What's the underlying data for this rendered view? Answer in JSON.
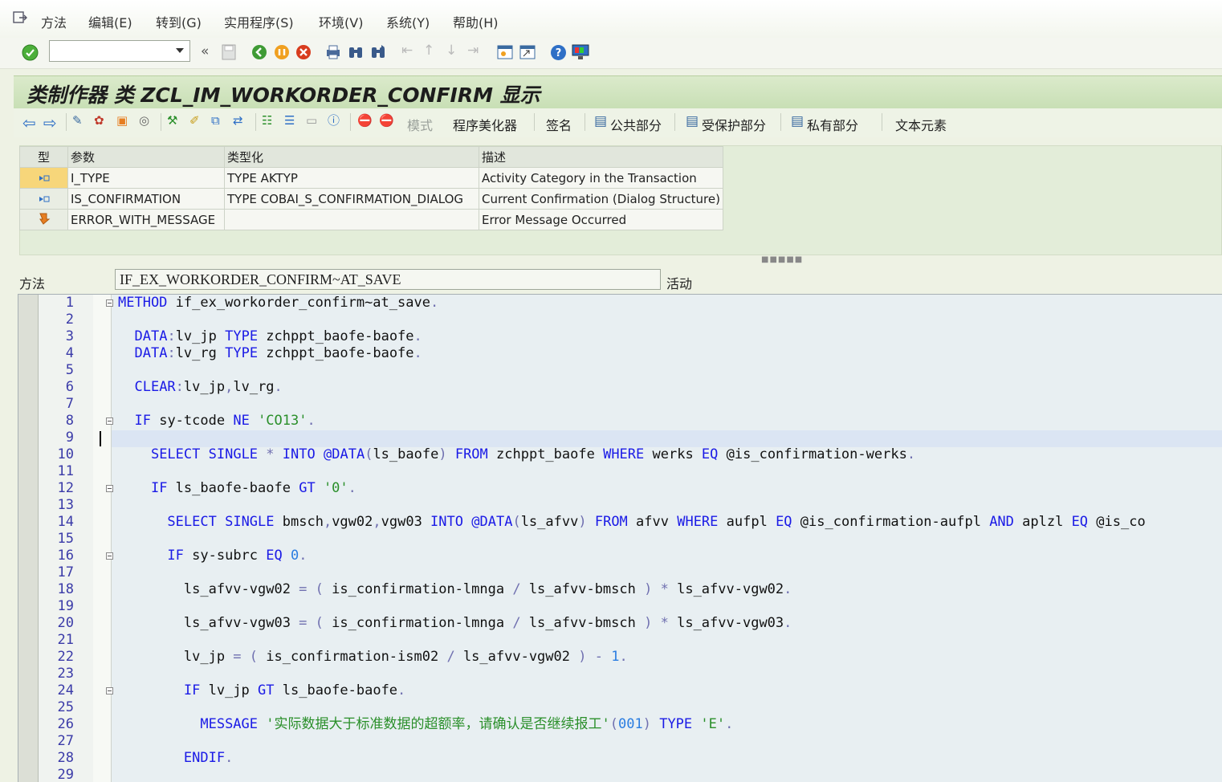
{
  "menu": {
    "items": [
      "方法",
      "编辑(E)",
      "转到(G)",
      "实用程序(S)",
      "环境(V)",
      "系统(Y)",
      "帮助(H)"
    ]
  },
  "toolbar": {
    "command_value": "",
    "overflow": "«"
  },
  "title": "类制作器 类 ZCL_IM_WORKORDER_CONFIRM 显示",
  "app_toolbar": {
    "mode": "模式",
    "pretty_printer": "程序美化器",
    "signature": "签名",
    "public": "公共部分",
    "protected": "受保护部分",
    "private": "私有部分",
    "text_elements": "文本元素"
  },
  "params": {
    "headers": {
      "type": "型",
      "param": "参数",
      "typing": "类型化",
      "desc": "描述"
    },
    "rows": [
      {
        "icon": "importing-icon",
        "name": "I_TYPE",
        "typing": "TYPE AKTYP",
        "desc": "Activity Category in the Transaction"
      },
      {
        "icon": "importing-icon",
        "name": "IS_CONFIRMATION",
        "typing": "TYPE COBAI_S_CONFIRMATION_DIALOG",
        "desc": "Current Confirmation (Dialog Structure)"
      },
      {
        "icon": "exception-icon",
        "name": "ERROR_WITH_MESSAGE",
        "typing": "",
        "desc": "Error Message Occurred"
      }
    ]
  },
  "method": {
    "label": "方法",
    "value": "IF_EX_WORKORDER_CONFIRM~AT_SAVE",
    "status": "活动"
  },
  "code_lines": [
    "METHOD if_ex_workorder_confirm~at_save.",
    "",
    "  DATA:lv_jp TYPE zchppt_baofe-baofe.",
    "  DATA:lv_rg TYPE zchppt_baofe-baofe.",
    "",
    "  CLEAR:lv_jp,lv_rg.",
    "",
    "  IF sy-tcode NE 'CO13'.",
    "",
    "    SELECT SINGLE * INTO @DATA(ls_baofe) FROM zchppt_baofe WHERE werks EQ @is_confirmation-werks.",
    "",
    "    IF ls_baofe-baofe GT '0'.",
    "",
    "      SELECT SINGLE bmsch,vgw02,vgw03 INTO @DATA(ls_afvv) FROM afvv WHERE aufpl EQ @is_confirmation-aufpl AND aplzl EQ @is_co",
    "",
    "      IF sy-subrc EQ 0.",
    "",
    "        ls_afvv-vgw02 = ( is_confirmation-lmnga / ls_afvv-bmsch ) * ls_afvv-vgw02.",
    "",
    "        ls_afvv-vgw03 = ( is_confirmation-lmnga / ls_afvv-bmsch ) * ls_afvv-vgw03.",
    "",
    "        lv_jp = ( is_confirmation-ism02 / ls_afvv-vgw02 ) - 1.",
    "",
    "        IF lv_jp GT ls_baofe-baofe.",
    "",
    "          MESSAGE '实际数据大于标准数据的超额率，请确认是否继续报工'(001) TYPE 'E'.",
    "",
    "        ENDIF.",
    ""
  ],
  "line_numbers": [
    "1",
    "2",
    "3",
    "4",
    "5",
    "6",
    "7",
    "8",
    "9",
    "10",
    "11",
    "12",
    "13",
    "14",
    "15",
    "16",
    "17",
    "18",
    "19",
    "20",
    "21",
    "22",
    "23",
    "24",
    "25",
    "26",
    "27",
    "28",
    "29"
  ]
}
